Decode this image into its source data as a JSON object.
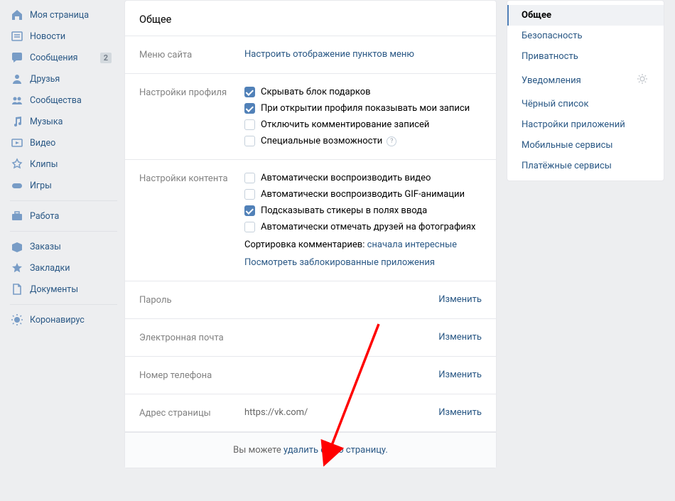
{
  "leftnav": {
    "items": [
      {
        "label": "Моя страница",
        "icon": "home-icon"
      },
      {
        "label": "Новости",
        "icon": "newspaper-icon"
      },
      {
        "label": "Сообщения",
        "icon": "message-icon",
        "badge": "2"
      },
      {
        "label": "Друзья",
        "icon": "person-icon"
      },
      {
        "label": "Сообщества",
        "icon": "people-icon"
      },
      {
        "label": "Музыка",
        "icon": "music-icon"
      },
      {
        "label": "Видео",
        "icon": "video-icon"
      },
      {
        "label": "Клипы",
        "icon": "clips-icon"
      },
      {
        "label": "Игры",
        "icon": "gamepad-icon"
      }
    ],
    "items2": [
      {
        "label": "Работа",
        "icon": "briefcase-icon"
      }
    ],
    "items3": [
      {
        "label": "Заказы",
        "icon": "box-icon"
      },
      {
        "label": "Закладки",
        "icon": "star-icon"
      },
      {
        "label": "Документы",
        "icon": "document-icon"
      }
    ],
    "items4": [
      {
        "label": "Коронавирус",
        "icon": "virus-icon"
      }
    ]
  },
  "header": {
    "title": "Общее"
  },
  "sitemenu": {
    "label": "Меню сайта",
    "link": "Настроить отображение пунктов меню"
  },
  "profile": {
    "label": "Настройки профиля",
    "opts": [
      {
        "text": "Скрывать блок подарков",
        "checked": true
      },
      {
        "text": "При открытии профиля показывать мои записи",
        "checked": true
      },
      {
        "text": "Отключить комментирование записей",
        "checked": false
      },
      {
        "text": "Специальные возможности",
        "checked": false,
        "help": true
      }
    ]
  },
  "content": {
    "label": "Настройки контента",
    "opts": [
      {
        "text": "Автоматически воспроизводить видео",
        "checked": false
      },
      {
        "text": "Автоматически воспроизводить GIF-анимации",
        "checked": false
      },
      {
        "text": "Подсказывать стикеры в полях ввода",
        "checked": true
      },
      {
        "text": "Автоматически отмечать друзей на фотографиях",
        "checked": false
      }
    ],
    "sort_prefix": "Сортировка комментариев: ",
    "sort_link": "сначала интересные",
    "blocked_link": "Посмотреть заблокированные приложения"
  },
  "password": {
    "label": "Пароль",
    "action": "Изменить"
  },
  "email": {
    "label": "Электронная почта",
    "action": "Изменить"
  },
  "phone": {
    "label": "Номер телефона",
    "action": "Изменить"
  },
  "address": {
    "label": "Адрес страницы",
    "value": "https://vk.com/",
    "action": "Изменить"
  },
  "footer": {
    "prefix": "Вы можете ",
    "link": "удалить свою страницу."
  },
  "rightnav": {
    "items": [
      {
        "label": "Общее",
        "active": true
      },
      {
        "label": "Безопасность"
      },
      {
        "label": "Приватность"
      },
      {
        "label": "Уведомления",
        "gear": true
      },
      {
        "label": "Чёрный список"
      },
      {
        "label": "Настройки приложений"
      },
      {
        "label": "Мобильные сервисы"
      },
      {
        "label": "Платёжные сервисы"
      }
    ]
  }
}
